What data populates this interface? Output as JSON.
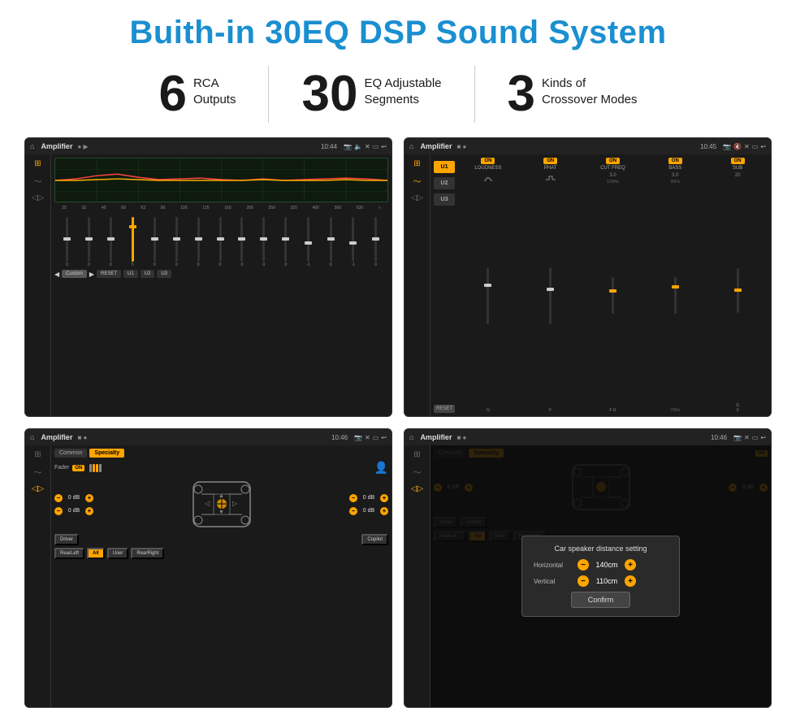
{
  "header": {
    "title": "Buith-in 30EQ DSP Sound System"
  },
  "stats": [
    {
      "number": "6",
      "line1": "RCA",
      "line2": "Outputs"
    },
    {
      "number": "30",
      "line1": "EQ Adjustable",
      "line2": "Segments"
    },
    {
      "number": "3",
      "line1": "Kinds of",
      "line2": "Crossover Modes"
    }
  ],
  "screens": [
    {
      "id": "screen1",
      "topbar": {
        "time": "10:44",
        "title": "Amplifier"
      }
    },
    {
      "id": "screen2",
      "topbar": {
        "time": "10:45",
        "title": "Amplifier"
      }
    },
    {
      "id": "screen3",
      "topbar": {
        "time": "10:46",
        "title": "Amplifier"
      }
    },
    {
      "id": "screen4",
      "topbar": {
        "time": "10:46",
        "title": "Amplifier"
      },
      "modal": {
        "title": "Car speaker distance setting",
        "horizontal_label": "Horizontal",
        "horizontal_value": "140cm",
        "vertical_label": "Vertical",
        "vertical_value": "110cm",
        "confirm_btn": "Confirm"
      }
    }
  ],
  "eq": {
    "frequencies": [
      "25",
      "32",
      "40",
      "50",
      "63",
      "80",
      "100",
      "125",
      "160",
      "200",
      "250",
      "320",
      "400",
      "500",
      "630"
    ],
    "values": [
      "0",
      "0",
      "0",
      "5",
      "0",
      "0",
      "0",
      "0",
      "0",
      "0",
      "0",
      "-1",
      "0",
      "-1"
    ],
    "preset": "Custom",
    "buttons": [
      "RESET",
      "U1",
      "U2",
      "U3"
    ]
  },
  "crossover": {
    "presets": [
      "U1",
      "U2",
      "U3"
    ],
    "channels": [
      {
        "label": "LOUDNESS",
        "on": true
      },
      {
        "label": "PHAT",
        "on": true
      },
      {
        "label": "CUT FREQ",
        "on": true
      },
      {
        "label": "BASS",
        "on": true
      },
      {
        "label": "SUB",
        "on": true
      }
    ],
    "reset_btn": "RESET"
  },
  "speaker": {
    "tabs": [
      "Common",
      "Specialty"
    ],
    "fader_label": "Fader",
    "volumes": [
      "0 dB",
      "0 dB",
      "0 dB",
      "0 dB"
    ],
    "buttons": {
      "driver": "Driver",
      "copilot": "Copilot",
      "rear_left": "RearLeft",
      "all": "All",
      "user": "User",
      "rear_right": "RearRight"
    }
  },
  "distance_modal": {
    "title": "Car speaker distance setting",
    "horizontal_label": "Horizontal",
    "horizontal_value": "140cm",
    "vertical_label": "Vertical",
    "vertical_value": "110cm",
    "confirm_btn": "Confirm",
    "vol_right1": "0 dB",
    "vol_right2": "0 dB"
  }
}
